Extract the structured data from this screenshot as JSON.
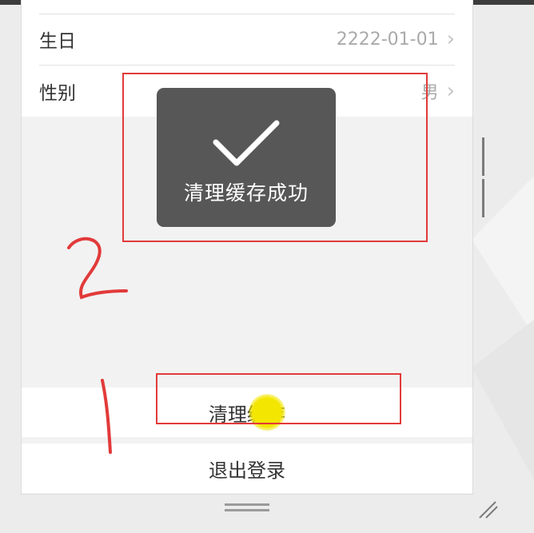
{
  "profile": {
    "birthday": {
      "label": "生日",
      "value": "2222-01-01"
    },
    "gender": {
      "label": "性别",
      "value": "男"
    }
  },
  "toast": {
    "message": "清理缓存成功",
    "icon": "checkmark-icon"
  },
  "actions": {
    "clear_cache": "清理缓存",
    "logout": "退出登录"
  },
  "annotations": {
    "step1": "1",
    "step2": "2",
    "color": "#e23a3a"
  },
  "cursor_highlight_color": "#f3e600"
}
